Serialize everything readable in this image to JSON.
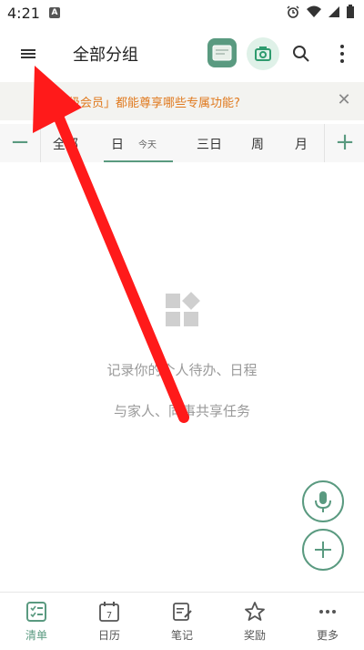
{
  "status": {
    "time": "4:21",
    "a_icon": "A"
  },
  "appbar": {
    "title": "全部分组"
  },
  "banner": {
    "text": "闪点高级会员」都能尊享哪些专属功能?"
  },
  "tabs": {
    "all": "全部",
    "day": "日",
    "today": "今天",
    "three_days": "三日",
    "week": "周",
    "month": "月"
  },
  "empty": {
    "line1": "记录你的个人待办、日程",
    "line2": "与家人、同事共享任务"
  },
  "bottom_nav": {
    "list": "清单",
    "calendar": "日历",
    "calendar_day": "7",
    "notes": "笔记",
    "rewards": "奖励",
    "more": "更多"
  },
  "colors": {
    "accent": "#5a9a80",
    "banner_text": "#e07a1f",
    "arrow": "#ff1a1a"
  }
}
